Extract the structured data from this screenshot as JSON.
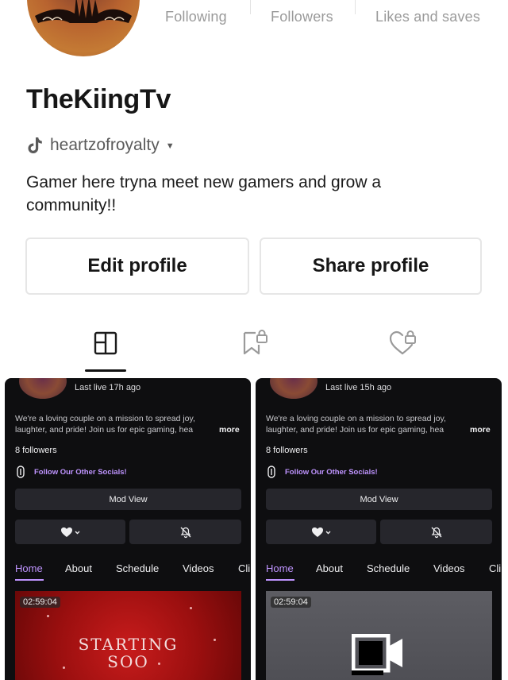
{
  "profile": {
    "stats": {
      "following_label": "Following",
      "followers_label": "Followers",
      "likes_label": "Likes and saves"
    },
    "display_name": "TheKiingTv",
    "handle": "heartzofroyalty",
    "bio": "Gamer here tryna meet new gamers and grow a community!!",
    "edit_button": "Edit profile",
    "share_button": "Share profile"
  },
  "tabs": [
    {
      "icon": "grid-icon",
      "active": true
    },
    {
      "icon": "bookmark-lock-icon",
      "active": false
    },
    {
      "icon": "heart-lock-icon",
      "active": false
    }
  ],
  "thumbnails": [
    {
      "last_live": "Last live 17h ago",
      "desc_line1": "We're a loving couple on a mission to spread joy,",
      "desc_line2": "laughter, and pride! Join us for epic gaming, hea",
      "more": "more",
      "followers": "8 followers",
      "socials": "Follow Our Other Socials!",
      "mod_view": "Mod View",
      "nav": [
        "Home",
        "About",
        "Schedule",
        "Videos",
        "Cli"
      ],
      "duration": "02:59:04",
      "overlay_line1": "STARTING",
      "overlay_line2": "SOO"
    },
    {
      "last_live": "Last live 15h ago",
      "desc_line1": "We're a loving couple on a mission to spread joy,",
      "desc_line2": "laughter, and pride! Join us for epic gaming, hea",
      "more": "more",
      "followers": "8 followers",
      "socials": "Follow Our Other Socials!",
      "mod_view": "Mod View",
      "nav": [
        "Home",
        "About",
        "Schedule",
        "Videos",
        "Cli"
      ],
      "duration": "02:59:04"
    }
  ],
  "colors": {
    "twitch_purple": "#bf94ff",
    "thumb_bg": "#0e0e10"
  }
}
